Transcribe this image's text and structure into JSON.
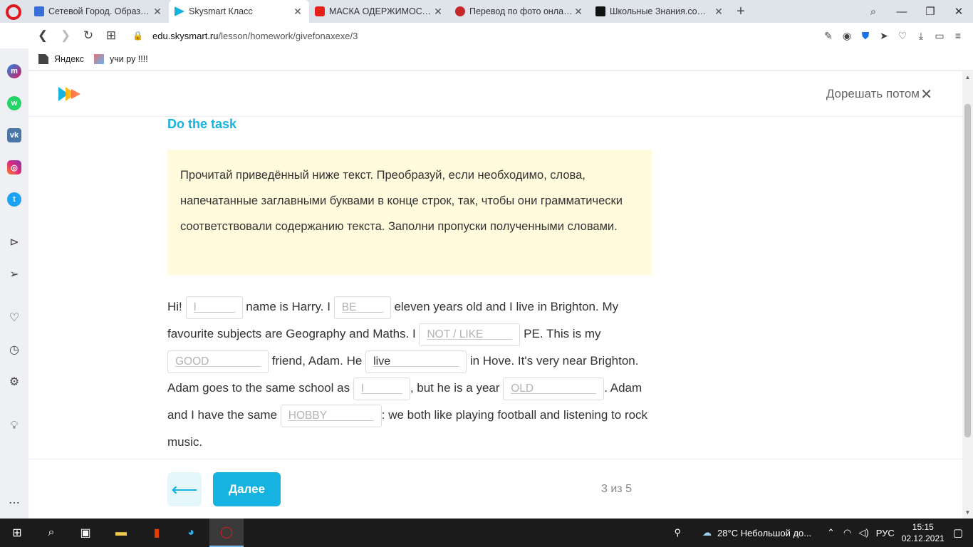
{
  "browser": {
    "tabs": [
      {
        "title": "Сетевой Город. Образова",
        "color": "#3b6fd8",
        "active": false
      },
      {
        "title": "Skysmart Класс",
        "color": "#16b2e0",
        "active": true
      },
      {
        "title": "МАСКА ОДЕРЖИМОСТИ",
        "color": "#e62117",
        "active": false
      },
      {
        "title": "Перевод по фото онлайн",
        "color": "#c62828",
        "active": false
      },
      {
        "title": "Школьные Знания.com - Р",
        "color": "#111111",
        "active": false
      }
    ],
    "new_tab": "+",
    "url_domain": "edu.skysmart.ru",
    "url_path": "/lesson/homework/givefonaxexe/3",
    "bookmarks": [
      {
        "label": "Яндекс"
      },
      {
        "label": "учи ру !!!!"
      }
    ]
  },
  "page": {
    "later_label": "Дорешать потом",
    "task_title": "Do the task",
    "instruction": "Прочитай приведённый ниже текст. Преобразуй, если необходимо, слова, напечатанные заглавными буквами в конце строк, так, чтобы они грамматически соответствовали содержанию текста. Заполни пропуски полученными словами.",
    "text": {
      "s1": "Hi!",
      "g1": "I",
      "s2": "name is Harry. I",
      "g2": "BE",
      "s3": "eleven years old and I live in Brighton. My favourite subjects are Geography and Maths. I",
      "g3": "NOT / LIKE",
      "s4": "PE. This is my",
      "g4": "GOOD",
      "s5": "friend, Adam. He",
      "g5": "live",
      "s6": "in Hove. It's very near Brighton. Adam goes to the same school as",
      "g6": "I",
      "s7": ", but he is a year",
      "g7": "OLD",
      "s8": ". Adam and I have the same",
      "g8": "HOBBY",
      "s9": ": we both like playing football and listening to rock music."
    },
    "next_label": "Далее",
    "progress": "3 из 5"
  },
  "taskbar": {
    "weather": "28°C  Небольшой до...",
    "lang": "РУС",
    "time": "15:15",
    "date": "02.12.2021"
  },
  "colors": {
    "accent": "#16b2e0",
    "instruction_bg": "#fffbdc"
  }
}
